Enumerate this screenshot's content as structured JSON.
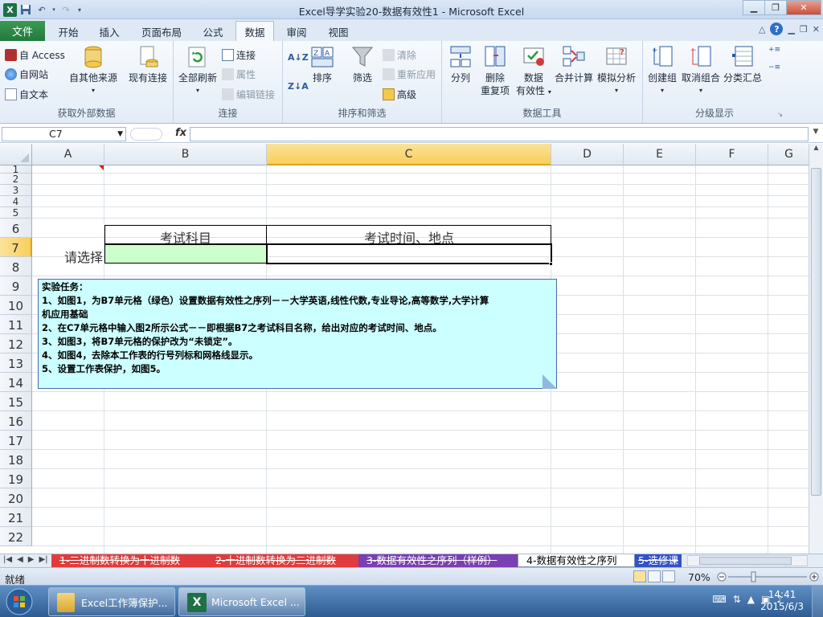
{
  "window": {
    "title": "Excel导学实验20-数据有效性1 - Microsoft Excel"
  },
  "ribbon_tabs": [
    {
      "label": "文件"
    },
    {
      "label": "开始"
    },
    {
      "label": "插入"
    },
    {
      "label": "页面布局"
    },
    {
      "label": "公式"
    },
    {
      "label": "数据",
      "active": true
    },
    {
      "label": "审阅"
    },
    {
      "label": "视图"
    }
  ],
  "ribbon": {
    "get_external": {
      "label": "获取外部数据",
      "access": "自 Access",
      "web": "自网站",
      "text": "自文本",
      "other": "自其他来源",
      "existing": "现有连接"
    },
    "connections": {
      "label": "连接",
      "refresh_all": "全部刷新",
      "connections": "连接",
      "properties": "属性",
      "edit_links": "编辑链接"
    },
    "sort_filter": {
      "label": "排序和筛选",
      "sort": "排序",
      "filter": "筛选",
      "clear": "清除",
      "reapply": "重新应用",
      "advanced": "高级"
    },
    "data_tools": {
      "label": "数据工具",
      "text_to_columns": "分列",
      "remove_dup_1": "删除",
      "remove_dup_2": "重复项",
      "validation_1": "数据",
      "validation_2": "有效性",
      "consolidate": "合并计算",
      "what_if": "模拟分析"
    },
    "outline": {
      "label": "分级显示",
      "group": "创建组",
      "ungroup": "取消组合",
      "subtotal": "分类汇总"
    }
  },
  "formula_bar": {
    "name_box": "C7",
    "fx": "fx",
    "formula": ""
  },
  "grid": {
    "columns": [
      "A",
      "B",
      "C",
      "D",
      "E",
      "F",
      "G"
    ],
    "selected_column": "C",
    "rows": [
      "1",
      "2",
      "3",
      "4",
      "5",
      "6",
      "7",
      "8",
      "9",
      "10",
      "11",
      "12",
      "13",
      "14",
      "15",
      "16",
      "17",
      "18",
      "19",
      "20",
      "21",
      "22"
    ],
    "selected_row": "7",
    "cells": {
      "B6": "考试科目",
      "C6": "考试时间、地点",
      "A7": "请选择",
      "B7": "",
      "C7": ""
    },
    "b7_fill": "#ccffcc"
  },
  "note": {
    "lines": [
      "实验任务：",
      "1、如图1，为B7单元格（绿色）设置数据有效性之序列－－大学英语,线性代数,专业导论,高等数学,大学计算",
      "机应用基础",
      "2、在C7单元格中输入图2所示公式－－即根据B7之考试科目名称，给出对应的考试时间、地点。",
      "3、如图3，将B7单元格的保护改为“未锁定”。",
      "4、如图4，去除本工作表的行号列标和网格线显示。",
      "5、设置工作表保护，如图5。"
    ]
  },
  "sheet_tabs": [
    {
      "label": "1-二进制数转换为十进制数",
      "style": "red"
    },
    {
      "label": "2-十进制数转换为二进制数",
      "style": "red"
    },
    {
      "label": "3-数据有效性之序列（样例）",
      "style": "purple"
    },
    {
      "label": "4-数据有效性之序列",
      "style": "active"
    },
    {
      "label": "5-选修课",
      "style": "blue"
    }
  ],
  "status": {
    "text": "就绪",
    "zoom": "70%"
  },
  "taskbar": {
    "items": [
      {
        "label": "Excel工作簿保护..."
      },
      {
        "label": "Microsoft Excel ..."
      }
    ],
    "time": "14:41",
    "date": "2015/6/3"
  },
  "colors": {
    "excel_green": "#217a3c",
    "selection_header": "#f7cf5a",
    "note_fill": "#ccffff",
    "sheet_tab_red": "#e23b3b",
    "sheet_tab_purple": "#7a3fb0",
    "sheet_tab_blue": "#3352c9"
  }
}
